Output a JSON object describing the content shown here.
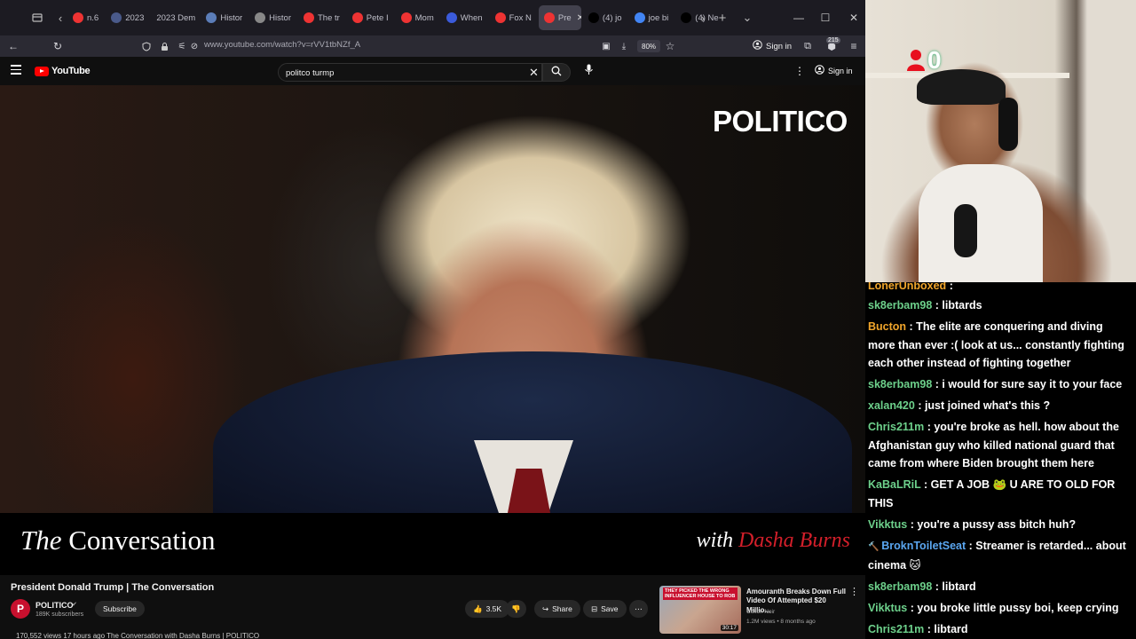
{
  "browser": {
    "tabs": [
      {
        "label": "n.6",
        "favicon": "youtube-icon",
        "color": "#e33"
      },
      {
        "label": "2023",
        "favicon": "globe-icon",
        "color": "#4a5a8a"
      },
      {
        "label": "2023 Dem",
        "favicon": "",
        "color": ""
      },
      {
        "label": "Histor",
        "favicon": "ai-icon",
        "color": "#5b7db8"
      },
      {
        "label": "Histor",
        "favicon": "wikipedia-icon",
        "color": "#888"
      },
      {
        "label": "The tr",
        "favicon": "youtube-icon",
        "color": "#e33"
      },
      {
        "label": "Pete I",
        "favicon": "youtube-icon",
        "color": "#e33"
      },
      {
        "label": "Mom",
        "favicon": "youtube-icon",
        "color": "#e33"
      },
      {
        "label": "When",
        "favicon": "bookmark-icon",
        "color": "#3b5bdb"
      },
      {
        "label": "Fox N",
        "favicon": "youtube-icon",
        "color": "#e33"
      },
      {
        "label": "Pre",
        "favicon": "youtube-icon",
        "color": "#e33",
        "active": true
      },
      {
        "label": "(4) jo",
        "favicon": "x-icon",
        "color": "#000"
      },
      {
        "label": "joe bi",
        "favicon": "google-icon",
        "color": "#4285f4"
      },
      {
        "label": "(4) Ne",
        "favicon": "x-icon",
        "color": "#000"
      }
    ],
    "url": "www.youtube.com/watch?v=rVV1tbNZf_A",
    "zoom": "80%",
    "sign_in": "Sign in",
    "extension_badge": "215"
  },
  "youtube": {
    "logo_text": "YouTube",
    "search": {
      "value": "politco turmp",
      "placeholder": "Search"
    },
    "sign_in": "Sign in",
    "video": {
      "watermark": "POLITICO",
      "show_title_italic": "The",
      "show_title_rest": "Conversation",
      "host_prefix": "with",
      "host_name": "Dasha Burns"
    },
    "title": "President Donald Trump | The Conversation",
    "channel": {
      "name": "POLITICO",
      "avatar_letter": "P",
      "subscribers": "189K subscribers"
    },
    "subscribe_label": "Subscribe",
    "likes": "3.5K",
    "share_label": "Share",
    "save_label": "Save",
    "views_line": "170,552 views  17 hours ago  The Conversation with Dasha Burns | POLITICO",
    "recommendation": {
      "thumb_text": "THEY PICKED THE WRONG INFLUENCER HOUSE TO ROB",
      "duration": "30:17",
      "title": "Amouranth Breaks Down Full Video Of Attempted $20 Millio...",
      "channel": "Colion Noir",
      "meta": "1.2M views • 8 months ago"
    }
  },
  "stream": {
    "viewer_count": "0",
    "chat": [
      {
        "user": "LonerUnboxed",
        "message": ":",
        "color": "#f0a52b",
        "partial": true
      },
      {
        "user": "sk8erbam98",
        "message": ": libtards",
        "color": "#6dd08b"
      },
      {
        "user": "Bucton",
        "message": ": The elite are conquering and diving more than ever :( look at us... constantly fighting each other instead of fighting together",
        "color": "#f0a52b"
      },
      {
        "user": "sk8erbam98",
        "message": ": i would for sure say it to your face",
        "color": "#6dd08b"
      },
      {
        "user": "xalan420",
        "message": ": just joined what's this ?",
        "color": "#6dd08b"
      },
      {
        "user": "Chris211m",
        "message": ": you're broke as hell. how about the Afghanistan guy who killed national guard that came from where Biden brought them here",
        "color": "#6dd08b"
      },
      {
        "user": "KaBaLRiL",
        "message": ": GET A JOB 🐸 U ARE TO OLD FOR THIS",
        "color": "#6dd08b"
      },
      {
        "user": "Vikktus",
        "message": ": you're a pussy ass bitch huh?",
        "color": "#6dd08b"
      },
      {
        "user": "BroknToiletSeat",
        "message": ": Streamer is retarded... about cinema 🐱",
        "color": "#5aa6f0",
        "badge": true
      },
      {
        "user": "sk8erbam98",
        "message": ": libtard",
        "color": "#6dd08b"
      },
      {
        "user": "Vikktus",
        "message": ": you broke little pussy boi, keep crying",
        "color": "#6dd08b"
      },
      {
        "user": "Chris211m",
        "message": ": libtard",
        "color": "#6dd08b"
      }
    ]
  }
}
